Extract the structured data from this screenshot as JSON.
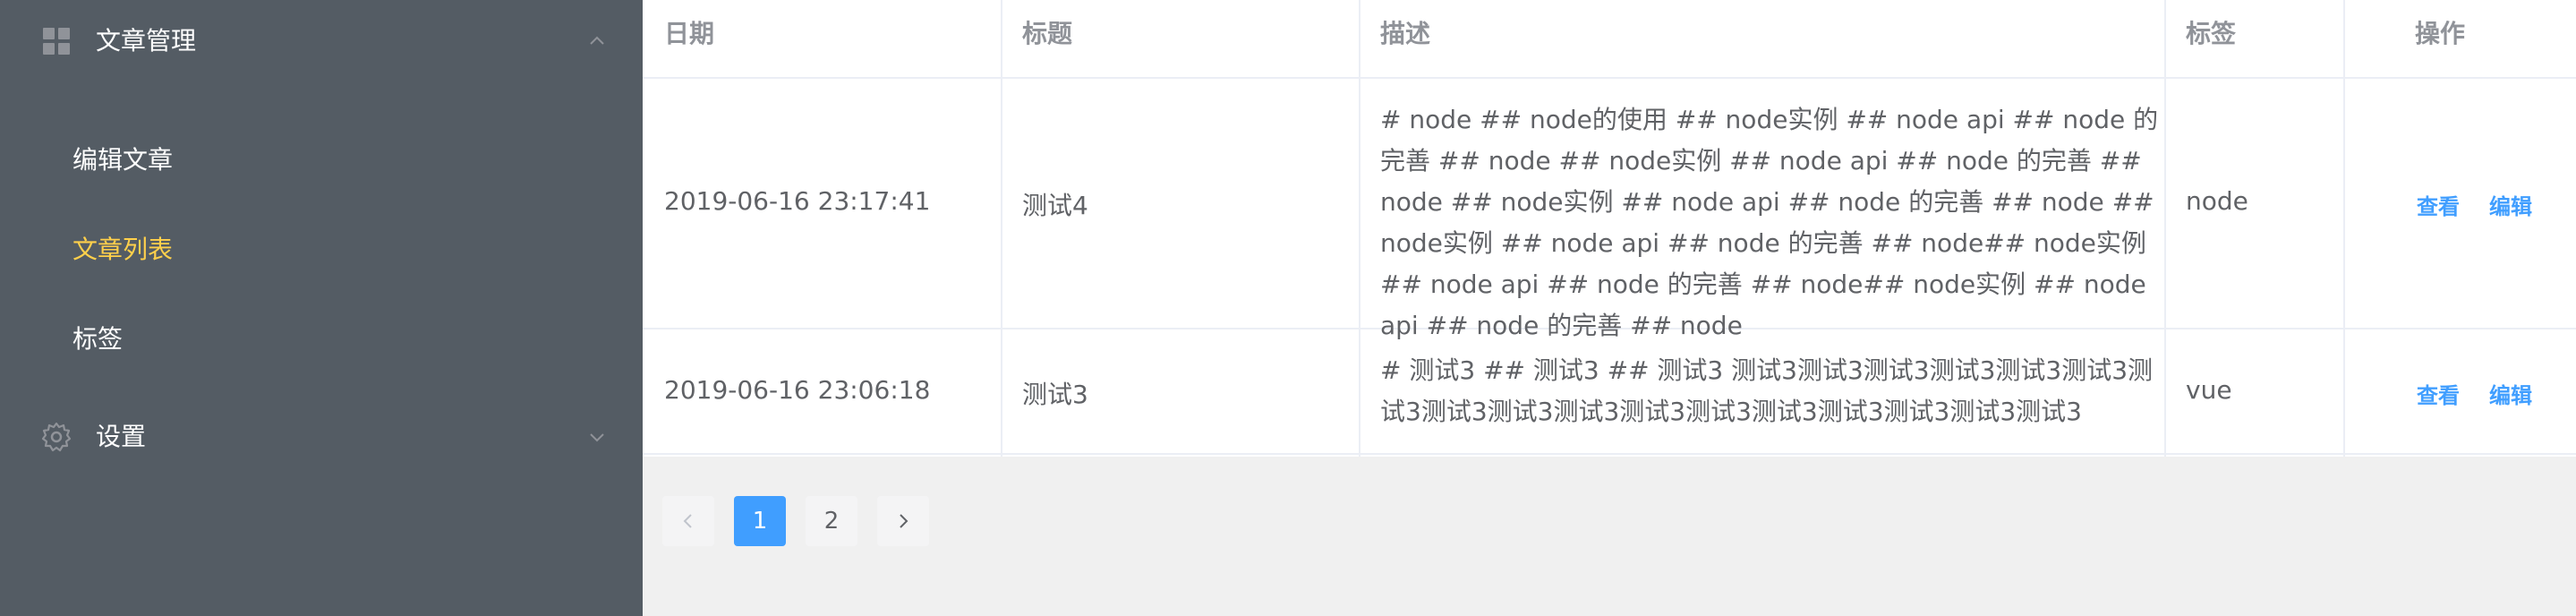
{
  "sidebar": {
    "group_title": "文章管理",
    "items": [
      {
        "label": "编辑文章",
        "active": false
      },
      {
        "label": "文章列表",
        "active": true
      },
      {
        "label": "标签",
        "active": false
      }
    ],
    "settings_label": "设置",
    "colors": {
      "background": "#545c64",
      "text": "#ffffff",
      "active": "#ffd04b"
    }
  },
  "table": {
    "headers": [
      "日期",
      "标题",
      "描述",
      "标签",
      "操作"
    ],
    "rows": [
      {
        "date": "2019-06-16 23:17:41",
        "title": "测试4",
        "desc": "# node ## node的使用 ## node实例 ## node api ## node 的完善 ## node ## node实例 ## node api ## node 的完善 ## node ## node实例 ## node api ## node 的完善 ## node ## node实例 ## node api ## node 的完善 ## node## node实例 ## node api ## node 的完善 ## node## node实例 ## node api ## node 的完善 ## node",
        "tag": "node",
        "view": "查看",
        "edit": "编辑"
      },
      {
        "date": "2019-06-16 23:06:18",
        "title": "测试3",
        "desc": "# 测试3 ## 测试3 ## 测试3 测试3测试3测试3测试3测试3测试3测试3测试3测试3测试3测试3测试3测试3测试3测试3测试3测试3",
        "tag": "vue",
        "view": "查看",
        "edit": "编辑"
      }
    ]
  },
  "pagination": {
    "pages": [
      "1",
      "2"
    ],
    "current": "1",
    "accent": "#409eff"
  },
  "icons": {
    "menu": "grid-icon",
    "settings": "gear-icon",
    "prev": "chevron-left-icon",
    "next": "chevron-right-icon",
    "collapse": "chevron-up-icon",
    "expand": "chevron-down-icon"
  }
}
